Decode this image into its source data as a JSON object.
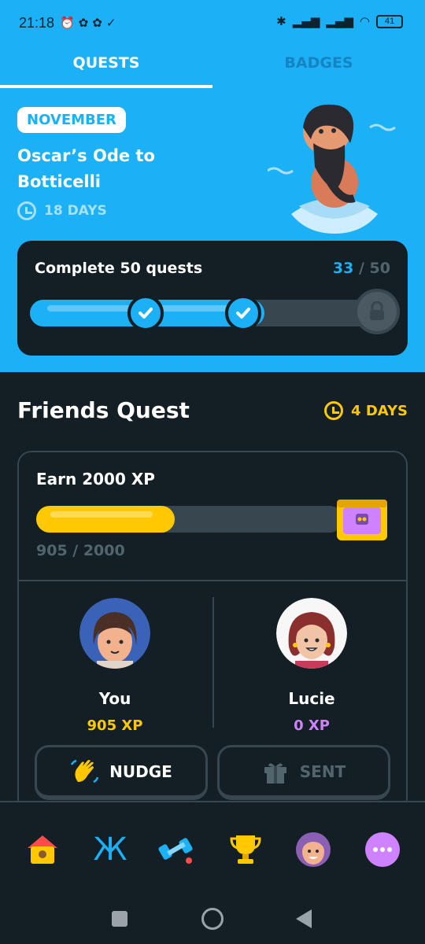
{
  "status_bar": {
    "time": "21:18",
    "battery": "41"
  },
  "tabs": [
    {
      "label": "QUESTS",
      "active": true
    },
    {
      "label": "BADGES",
      "active": false
    }
  ],
  "monthly": {
    "month": "NOVEMBER",
    "title": "Oscar’s Ode to Botticelli",
    "days_left": "18 DAYS",
    "challenge": "Complete 50 quests",
    "progress_current": "33",
    "progress_total": "/ 50",
    "progress_fraction": 0.66
  },
  "friends_quest": {
    "title": "Friends Quest",
    "days_left": "4 DAYS",
    "goal": "Earn 2000 XP",
    "progress_text": "905 / 2000",
    "progress_fraction": 0.4525,
    "members": [
      {
        "name": "You",
        "xp": "905 XP",
        "xp_color": "#ffc800"
      },
      {
        "name": "Lucie",
        "xp": "0 XP",
        "xp_color": "#ce82ff"
      }
    ],
    "nudge_label": "NUDGE",
    "sent_label": "SENT"
  },
  "nav": [
    "home-icon",
    "letters-icon",
    "practice-icon",
    "leaderboard-trophy-icon",
    "profile-icon",
    "more-icon"
  ],
  "colors": {
    "accent": "#1cb0f6",
    "background": "#131f24",
    "gold": "#ffc800",
    "purple": "#ce82ff"
  }
}
